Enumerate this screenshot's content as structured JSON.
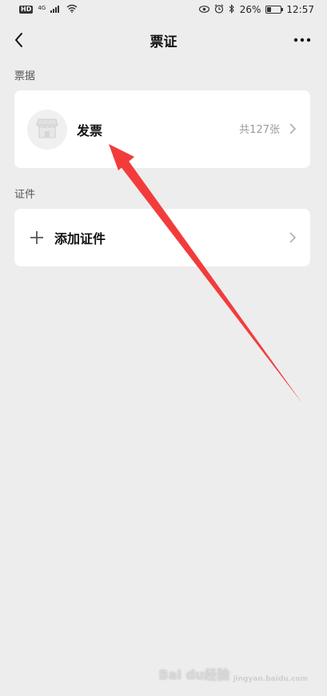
{
  "status_bar": {
    "hd": "HD",
    "network": "4G",
    "battery_text": "26%",
    "battery_level": 0.26,
    "time": "12:57"
  },
  "nav": {
    "title": "票证",
    "back_icon": "chevron-left-icon",
    "more_icon": "more-dots-icon"
  },
  "sections": {
    "receipts_label": "票据",
    "certificates_label": "证件"
  },
  "invoice_item": {
    "label": "发票",
    "count_text": "共127张",
    "icon": "storefront-icon"
  },
  "add_certificate_item": {
    "label": "添加证件",
    "icon": "plus-icon"
  },
  "annotation": {
    "arrow_color": "#f23c3c"
  },
  "watermark": {
    "main": "Bai du经验",
    "sub": "jingyan.baidu.com"
  }
}
